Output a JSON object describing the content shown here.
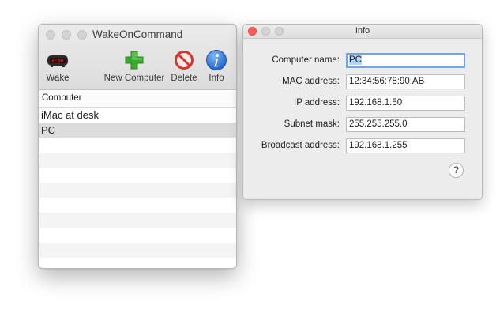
{
  "main_window": {
    "title": "WakeOnCommand",
    "toolbar": {
      "wake_label": "Wake",
      "new_computer_label": "New Computer",
      "delete_label": "Delete",
      "info_label": "Info"
    },
    "table": {
      "column_header": "Computer",
      "rows": [
        "iMac at desk",
        "PC"
      ],
      "selected_row": "PC"
    }
  },
  "info_window": {
    "title": "Info",
    "fields": {
      "computer_name": {
        "label": "Computer name:",
        "value": "PC"
      },
      "mac_address": {
        "label": "MAC address:",
        "value": "12:34:56:78:90:AB"
      },
      "ip_address": {
        "label": "IP address:",
        "value": "192.168.1.50"
      },
      "subnet_mask": {
        "label": "Subnet mask:",
        "value": "255.255.255.0"
      },
      "broadcast_address": {
        "label": "Broadcast address:",
        "value": "192.168.1.255"
      }
    },
    "help_label": "?"
  },
  "colors": {
    "close_button": "#ff5f57",
    "focus_ring": "#6ea6e6",
    "new_computer_icon": "#3aa82f",
    "delete_icon": "#d8362a",
    "info_icon": "#2f7de0"
  },
  "icons": {
    "wake": "alarm-clock-icon",
    "new_computer": "plus-icon",
    "delete": "no-entry-icon",
    "info": "info-icon",
    "help": "help-icon"
  }
}
